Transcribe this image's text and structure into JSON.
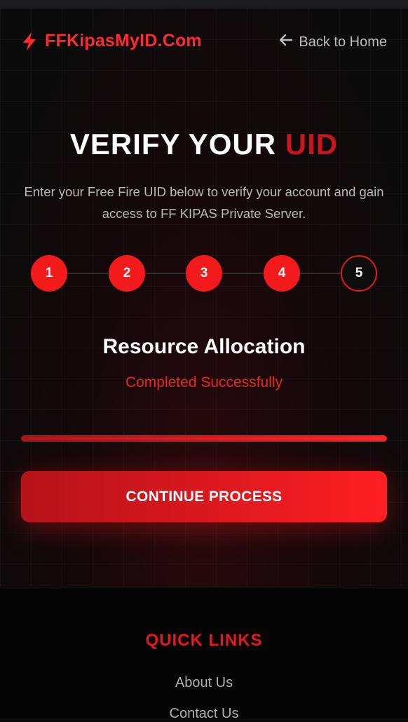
{
  "header": {
    "brand": "FFKipasMyID.Com",
    "back_label": "Back to Home"
  },
  "hero": {
    "title_main": "VERIFY YOUR ",
    "title_accent": "UID",
    "subtitle": "Enter your Free Fire UID below to verify your account and gain access to FF KIPAS Private Server."
  },
  "steps": [
    "1",
    "2",
    "3",
    "4",
    "5"
  ],
  "current_step": 5,
  "status": {
    "title": "Resource Allocation",
    "subtitle": "Completed Successfully",
    "progress": 1.0
  },
  "cta_label": "CONTINUE PROCESS",
  "footer": {
    "quick_links_title": "QUICK LINKS",
    "links": [
      "About Us",
      "Contact Us"
    ]
  },
  "colors": {
    "accent": "#f21a1a",
    "accent_dark": "#c8161b",
    "background": "#0b0a0b"
  },
  "icons": {
    "brand": "lightning-bolt-icon",
    "back": "arrow-left-icon"
  }
}
